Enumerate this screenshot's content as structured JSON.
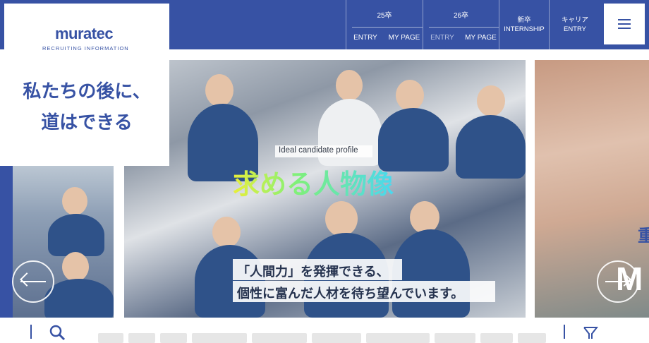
{
  "logo": {
    "wordmark": "muratec",
    "subtitle": "RECRUITING INFORMATION"
  },
  "tagline": {
    "line1": "私たちの後に、",
    "line2": "道はできる"
  },
  "nav": {
    "y25": {
      "label": "25卒",
      "entry": "ENTRY",
      "mypage": "MY PAGE"
    },
    "y26": {
      "label": "26卒",
      "entry": "ENTRY",
      "mypage": "MY PAGE"
    },
    "internship": {
      "line1": "新卒",
      "line2": "INTERNSHIP"
    },
    "career": {
      "line1": "キャリア",
      "line2": "ENTRY"
    }
  },
  "icons": {
    "menu": "hamburger-menu-icon",
    "prev": "arrow-left-icon",
    "next": "arrow-right-icon",
    "search": "search-icon",
    "filter": "funnel-icon"
  },
  "hero": {
    "label": "Ideal candidate profile",
    "title": "求める人物像",
    "caption1": "「人間力」を発揮できる、",
    "caption2": "個性に富んだ人材を待ち望んでいます。"
  },
  "next_slide": {
    "letter": "M",
    "kanji": "重"
  },
  "colors": {
    "brand_blue": "#3752a4",
    "white": "#ffffff",
    "title_gradient": [
      "#e8ef3a",
      "#7ff07a",
      "#49d8f0"
    ]
  }
}
